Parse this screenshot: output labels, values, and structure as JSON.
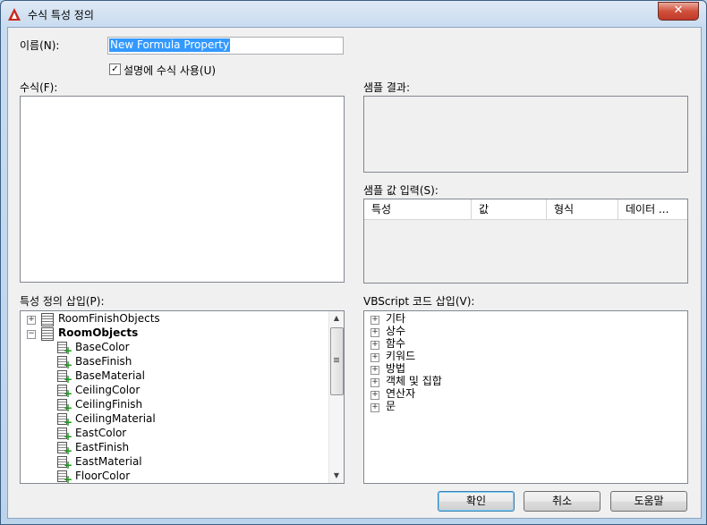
{
  "window": {
    "title": "수식 특성 정의",
    "close_glyph": "✕"
  },
  "form": {
    "name_label": "이름(N):",
    "name_value": "New Formula Property",
    "use_formula_label": "설명에 수식 사용(U)",
    "use_formula_checked": true,
    "formula_label": "수식(F):",
    "sample_result_label": "샘플 결과:",
    "sample_input_label": "샘플 값 입력(S):"
  },
  "sample_grid": {
    "columns": [
      "특성",
      "값",
      "형식",
      "데이터 ..."
    ]
  },
  "property_tree": {
    "label": "특성 정의 삽입(P):",
    "items": [
      {
        "text": "RoomFinishObjects",
        "level": 0,
        "expander": "+",
        "bold": false
      },
      {
        "text": "RoomObjects",
        "level": 0,
        "expander": "−",
        "bold": true
      },
      {
        "text": "BaseColor",
        "level": 1
      },
      {
        "text": "BaseFinish",
        "level": 1
      },
      {
        "text": "BaseMaterial",
        "level": 1
      },
      {
        "text": "CeilingColor",
        "level": 1
      },
      {
        "text": "CeilingFinish",
        "level": 1
      },
      {
        "text": "CeilingMaterial",
        "level": 1
      },
      {
        "text": "EastColor",
        "level": 1
      },
      {
        "text": "EastFinish",
        "level": 1
      },
      {
        "text": "EastMaterial",
        "level": 1
      },
      {
        "text": "FloorColor",
        "level": 1
      }
    ]
  },
  "vbscript_tree": {
    "label": "VBScript 코드 삽입(V):",
    "items": [
      "기타",
      "상수",
      "함수",
      "키워드",
      "방법",
      "객체 및 집합",
      "연산자",
      "문"
    ]
  },
  "buttons": {
    "ok": "확인",
    "cancel": "취소",
    "help": "도움말"
  },
  "colors": {
    "selection": "#3399ff",
    "title_gradient": "#c8dbef",
    "close_button": "#c0392b"
  }
}
